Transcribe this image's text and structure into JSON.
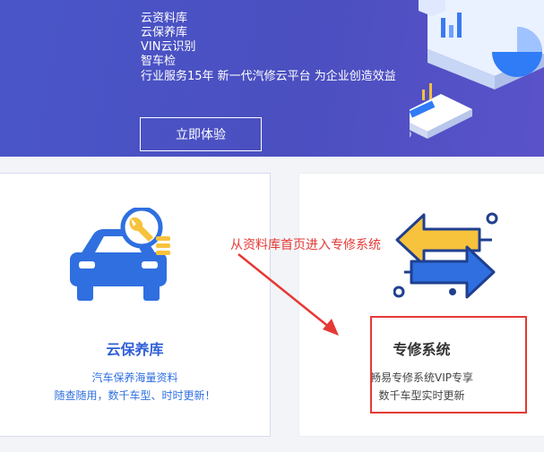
{
  "banner": {
    "features": [
      "云资料库",
      "云保养库",
      "VIN云识别",
      "智车检"
    ],
    "slogan": "行业服务15年  新一代汽修云平台  为企业创造效益",
    "cta_label": "立即体验"
  },
  "cards": {
    "left": {
      "title": "云保养库",
      "desc_line1": "汽车保养海量资料",
      "desc_line2": "随查随用，数千车型、时时更新！"
    },
    "right": {
      "title": "专修系统",
      "desc_line1": "畅易专修系统VIP专享",
      "desc_line2": "数千车型实时更新"
    }
  },
  "annotation": {
    "text": "从资料库首页进入专修系统"
  },
  "colors": {
    "banner_bg": "#4b4fc0",
    "accent_blue": "#2f6fe0",
    "annotation_red": "#e53935",
    "arrow_yellow": "#f7c23c"
  },
  "icons": {
    "left_card": "car-wrench-icon",
    "right_card": "exchange-arrows-icon"
  }
}
